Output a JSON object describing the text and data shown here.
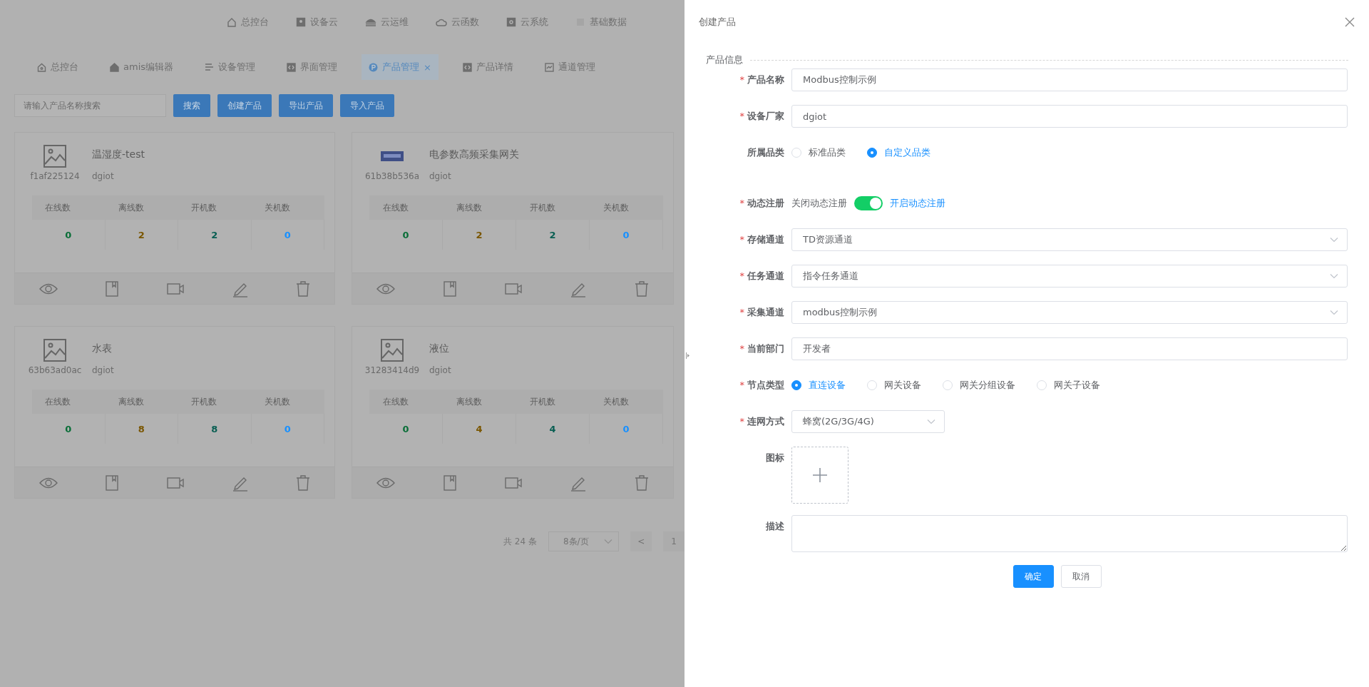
{
  "top_nav": [
    {
      "label": "总控台"
    },
    {
      "label": "设备云"
    },
    {
      "label": "云运维"
    },
    {
      "label": "云函数"
    },
    {
      "label": "云系统"
    },
    {
      "label": "基础数据"
    }
  ],
  "tabs": [
    {
      "label": "总控台",
      "selected": false
    },
    {
      "label": "amis编辑器",
      "selected": false
    },
    {
      "label": "设备管理",
      "selected": false
    },
    {
      "label": "界面管理",
      "selected": false
    },
    {
      "label": "产品管理",
      "selected": true,
      "close": "×"
    },
    {
      "label": "产品详情",
      "selected": false
    },
    {
      "label": "通道管理",
      "selected": false
    }
  ],
  "search": {
    "placeholder": "请输入产品名称搜索",
    "buttons": [
      "搜索",
      "创建产品",
      "导出产品",
      "导入产品"
    ]
  },
  "products": [
    {
      "name": "温湿度-test",
      "vendor": "dgiot",
      "id": "f1af225124",
      "kind": "placeholder",
      "stats": [
        {
          "label": "在线数",
          "value": "0",
          "color": "#0a6e38"
        },
        {
          "label": "离线数",
          "value": "2",
          "color": "#7a5600"
        },
        {
          "label": "开机数",
          "value": "2",
          "color": "#085e52"
        },
        {
          "label": "关机数",
          "value": "0",
          "color": "#1890ff"
        }
      ]
    },
    {
      "name": "电参数高频采集网关",
      "vendor": "dgiot",
      "id": "61b38b536a",
      "kind": "device",
      "stats": [
        {
          "label": "在线数",
          "value": "0",
          "color": "#0a6e38"
        },
        {
          "label": "离线数",
          "value": "2",
          "color": "#7a5600"
        },
        {
          "label": "开机数",
          "value": "2",
          "color": "#085e52"
        },
        {
          "label": "关机数",
          "value": "0",
          "color": "#1890ff"
        }
      ]
    },
    {
      "name": "水表",
      "vendor": "dgiot",
      "id": "63b63ad0ac",
      "kind": "placeholder",
      "stats": [
        {
          "label": "在线数",
          "value": "0",
          "color": "#0a6e38"
        },
        {
          "label": "离线数",
          "value": "8",
          "color": "#7a5600"
        },
        {
          "label": "开机数",
          "value": "8",
          "color": "#085e52"
        },
        {
          "label": "关机数",
          "value": "0",
          "color": "#1890ff"
        }
      ]
    },
    {
      "name": "液位",
      "vendor": "dgiot",
      "id": "31283414d9",
      "kind": "placeholder",
      "stats": [
        {
          "label": "在线数",
          "value": "0",
          "color": "#0a6e38"
        },
        {
          "label": "离线数",
          "value": "4",
          "color": "#7a5600"
        },
        {
          "label": "开机数",
          "value": "4",
          "color": "#085e52"
        },
        {
          "label": "关机数",
          "value": "0",
          "color": "#1890ff"
        }
      ]
    }
  ],
  "pagination": {
    "total": "共 24 条",
    "page_size": "8条/页",
    "prev": "<",
    "page": "1"
  },
  "drawer": {
    "title": "创建产品",
    "section": "产品信息",
    "fields": [
      {
        "kind": "input",
        "label": "产品名称",
        "required": "*",
        "value": "Modbus控制示例"
      },
      {
        "kind": "input",
        "label": "设备厂家",
        "required": "*",
        "value": "dgiot"
      },
      {
        "kind": "radio",
        "label": "所属品类",
        "options": [
          {
            "label": "标准品类",
            "selected": false
          },
          {
            "label": "自定义品类",
            "selected": true
          }
        ]
      },
      {
        "kind": "switch",
        "label": "动态注册",
        "required": "*",
        "off_label": "关闭动态注册",
        "on_label": "开启动态注册",
        "on": true
      },
      {
        "kind": "select",
        "label": "存储通道",
        "required": "*",
        "value": "TD资源通道"
      },
      {
        "kind": "select",
        "label": "任务通道",
        "required": "*",
        "value": "指令任务通道"
      },
      {
        "kind": "select",
        "label": "采集通道",
        "required": "*",
        "value": "modbus控制示例"
      },
      {
        "kind": "input",
        "label": "当前部门",
        "required": "*",
        "value": "开发者"
      },
      {
        "kind": "radio",
        "label": "节点类型",
        "required": "*",
        "options": [
          {
            "label": "直连设备",
            "selected": true
          },
          {
            "label": "网关设备",
            "selected": false
          },
          {
            "label": "网关分组设备",
            "selected": false
          },
          {
            "label": "网关子设备",
            "selected": false
          }
        ]
      },
      {
        "kind": "picker",
        "label": "连网方式",
        "required": "*",
        "value": "蜂窝(2G/3G/4G)"
      },
      {
        "kind": "upload",
        "label": "图标"
      },
      {
        "kind": "textarea",
        "label": "描述"
      }
    ],
    "buttons": [
      {
        "label": "确定",
        "primary": true
      },
      {
        "label": "取消",
        "primary": false
      }
    ]
  }
}
